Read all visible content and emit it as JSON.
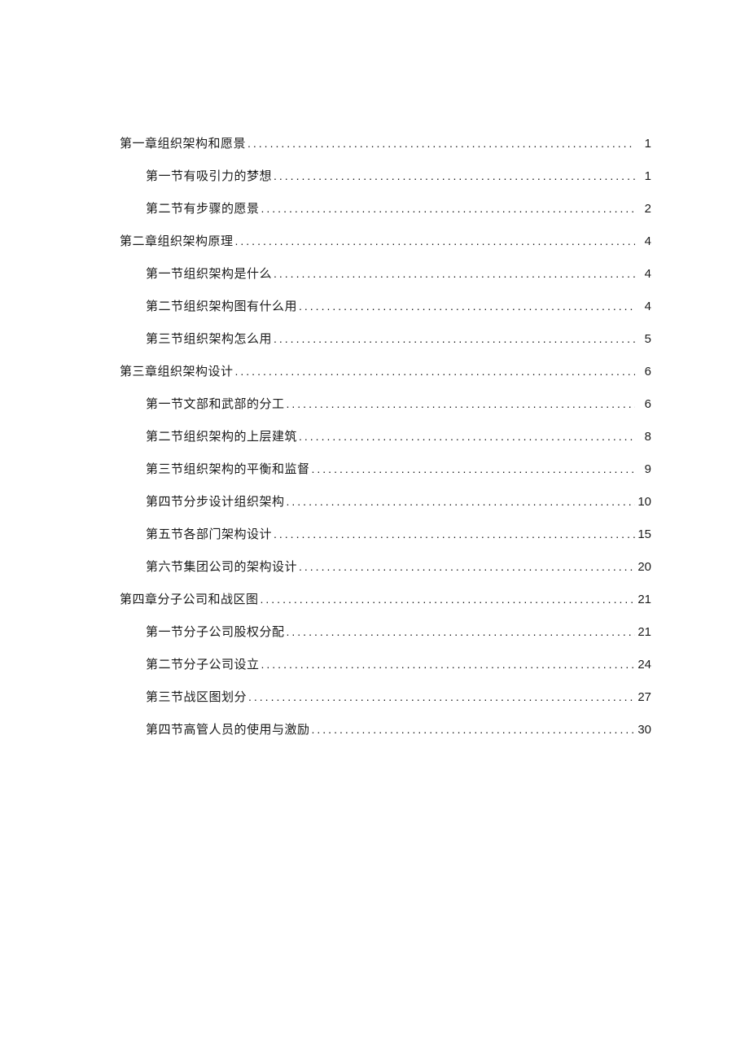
{
  "toc": [
    {
      "level": 1,
      "title": "第一章组织架构和愿景",
      "page": "1"
    },
    {
      "level": 2,
      "title": "第一节有吸引力的梦想",
      "page": "1"
    },
    {
      "level": 2,
      "title": "第二节有步骤的愿景",
      "page": "2"
    },
    {
      "level": 1,
      "title": "第二章组织架构原理",
      "page": "4"
    },
    {
      "level": 2,
      "title": "第一节组织架构是什么",
      "page": "4"
    },
    {
      "level": 2,
      "title": "第二节组织架构图有什么用",
      "page": "4"
    },
    {
      "level": 2,
      "title": "第三节组织架构怎么用",
      "page": "5"
    },
    {
      "level": 1,
      "title": "第三章组织架构设计",
      "page": "6"
    },
    {
      "level": 2,
      "title": "第一节文部和武部的分工",
      "page": "6"
    },
    {
      "level": 2,
      "title": "第二节组织架构的上层建筑",
      "page": "8"
    },
    {
      "level": 2,
      "title": "第三节组织架构的平衡和监督",
      "page": "9"
    },
    {
      "level": 2,
      "title": "第四节分步设计组织架构",
      "page": "10"
    },
    {
      "level": 2,
      "title": "第五节各部门架构设计",
      "page": "15"
    },
    {
      "level": 2,
      "title": "第六节集团公司的架构设计",
      "page": "20"
    },
    {
      "level": 1,
      "title": "第四章分子公司和战区图",
      "page": "21"
    },
    {
      "level": 2,
      "title": "第一节分子公司股权分配",
      "page": "21"
    },
    {
      "level": 2,
      "title": "第二节分子公司设立",
      "page": "24"
    },
    {
      "level": 2,
      "title": "第三节战区图划分",
      "page": "27"
    },
    {
      "level": 2,
      "title": "第四节高管人员的使用与激励",
      "page": "30"
    }
  ]
}
